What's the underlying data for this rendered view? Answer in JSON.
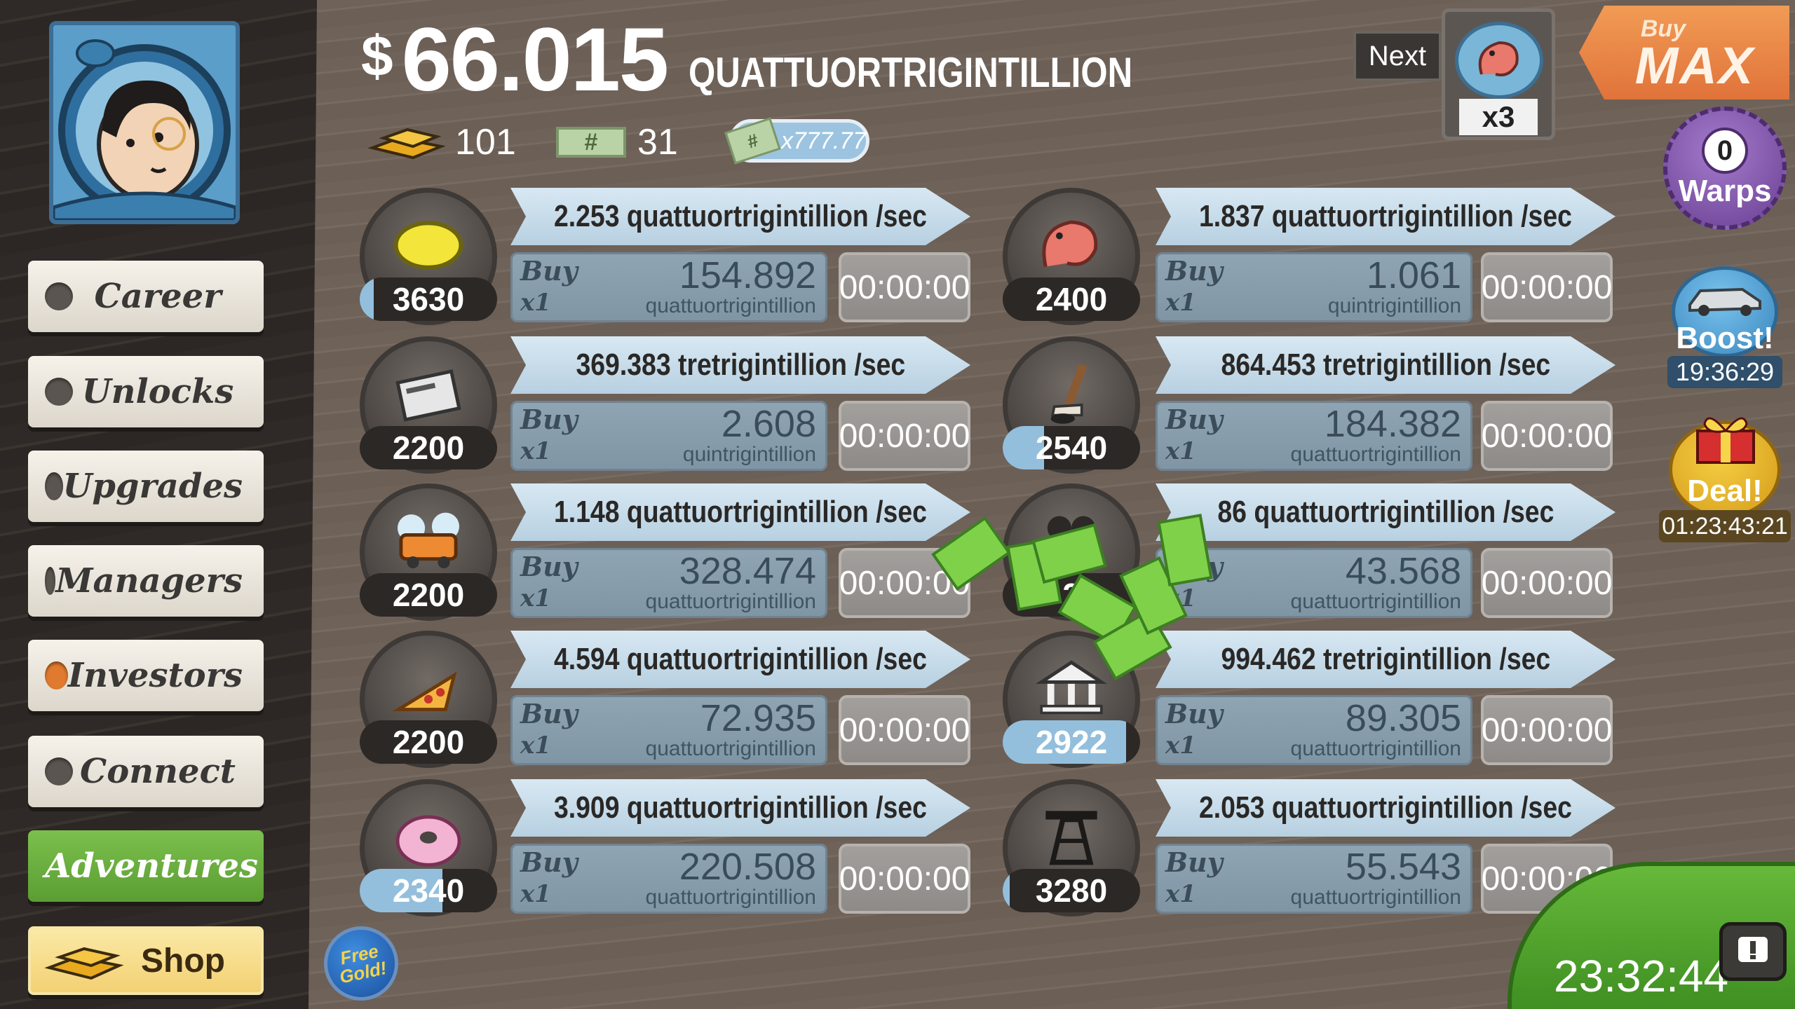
{
  "currency": {
    "amount": "66.015",
    "symbol": "$",
    "unit": "QUATTUORTRIGINTILLION",
    "gold": "101",
    "megabucks": "31",
    "mega_symbol": "#",
    "multiplier": "x777.77"
  },
  "nav": [
    {
      "label": "Career",
      "dot": "#5a5550"
    },
    {
      "label": "Unlocks",
      "dot": "#5a5550"
    },
    {
      "label": "Upgrades",
      "dot": "#5a5550"
    },
    {
      "label": "Managers",
      "dot": "#5a5550"
    },
    {
      "label": "Investors",
      "dot": "#e07a2e"
    },
    {
      "label": "Connect",
      "dot": "#5a5550"
    },
    {
      "label": "Adventures",
      "dot": "#5a5550"
    }
  ],
  "shop_label": "Shop",
  "free_gold_label": "Free Gold!",
  "next": {
    "label": "Next",
    "multiplier": "x3"
  },
  "buy_max": {
    "line1": "Buy",
    "line2": "MAX"
  },
  "warps": {
    "count": "0",
    "label": "Warps"
  },
  "boost": {
    "label": "Boost!",
    "timer": "19:36:29"
  },
  "deal": {
    "label": "Deal!",
    "timer": "01:23:43:21"
  },
  "clock": "23:32:44",
  "buy_label": "Buy",
  "buy_qty": "x1",
  "businesses": [
    {
      "icon": "lemon-icon",
      "count": "3630",
      "progress": 0.1,
      "rate": "2.253 quattuortrigintillion /sec",
      "cost": "154.892",
      "cost_unit": "quattuortrigintillion",
      "timer": "00:00:00"
    },
    {
      "icon": "newspaper-icon",
      "count": "2200",
      "progress": 0,
      "rate": "369.383 tretrigintillion /sec",
      "cost": "2.608",
      "cost_unit": "quintrigintillion",
      "timer": "00:00:00"
    },
    {
      "icon": "car-wash-icon",
      "count": "2200",
      "progress": 0,
      "rate": "1.148 quattuortrigintillion /sec",
      "cost": "328.474",
      "cost_unit": "quattuortrigintillion",
      "timer": "00:00:00"
    },
    {
      "icon": "pizza-icon",
      "count": "2200",
      "progress": 0,
      "rate": "4.594 quattuortrigintillion /sec",
      "cost": "72.935",
      "cost_unit": "quattuortrigintillion",
      "timer": "00:00:00"
    },
    {
      "icon": "donut-icon",
      "count": "2340",
      "progress": 0.6,
      "rate": "3.909 quattuortrigintillion /sec",
      "cost": "220.508",
      "cost_unit": "quattuortrigintillion",
      "timer": "00:00:00"
    },
    {
      "icon": "shrimp-icon",
      "count": "2400",
      "progress": 0,
      "rate": "1.837 quattuortrigintillion /sec",
      "cost": "1.061",
      "cost_unit": "quintrigintillion",
      "timer": "00:00:00"
    },
    {
      "icon": "hockey-icon",
      "count": "2540",
      "progress": 0.3,
      "rate": "864.453 tretrigintillion /sec",
      "cost": "184.382",
      "cost_unit": "quattuortrigintillion",
      "timer": "00:00:00"
    },
    {
      "icon": "movie-icon",
      "count": "2",
      "progress": 0,
      "rate": "86 quattuortrigintillion /sec",
      "cost": "43.568",
      "cost_unit": "quattuortrigintillion",
      "timer": "00:00:00"
    },
    {
      "icon": "bank-icon",
      "count": "2922",
      "progress": 0.9,
      "rate": "994.462 tretrigintillion /sec",
      "cost": "89.305",
      "cost_unit": "quattuortrigintillion",
      "timer": "00:00:00"
    },
    {
      "icon": "oil-rig-icon",
      "count": "3280",
      "progress": 0.05,
      "rate": "2.053 quattuortrigintillion /sec",
      "cost": "55.543",
      "cost_unit": "quattuortrigintillion",
      "timer": "00:00:00"
    }
  ]
}
